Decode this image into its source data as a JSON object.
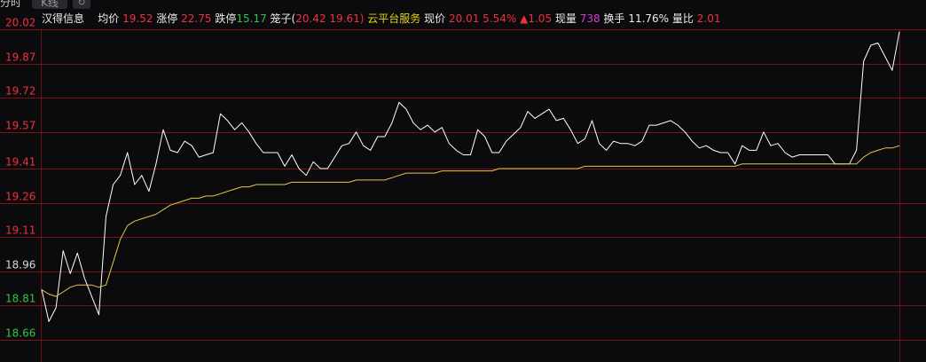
{
  "tabs": [
    {
      "label": "分时"
    },
    {
      "label": "K线"
    },
    {
      "label": "↻"
    }
  ],
  "info": {
    "name": "汉得信息",
    "avg_label": "均价",
    "avg": "19.52",
    "limit_up_label": "涨停",
    "limit_up": "22.75",
    "limit_down_label": "跌停",
    "limit_down": "15.17",
    "bidask_label": "笼子(",
    "bid": "20.42",
    "ask": "19.61)",
    "concept": "云平台服务",
    "price_label": "现价",
    "price": "20.01",
    "change_pct": "5.54%",
    "change": "▲1.05",
    "volume_label": "现量",
    "volume": "738",
    "turnover_label": "换手",
    "turnover": "11.76%",
    "ratio_label": "量比",
    "ratio": "2.01"
  },
  "colors": {
    "price_line": "#ffffff",
    "avg_line": "#e6c64a",
    "up": "#f0303c",
    "down": "#2fc24b",
    "grid": "#7a1414",
    "vline": "#6a1212"
  },
  "chart_data": {
    "type": "line",
    "y_ticks": [
      "20.02",
      "19.87",
      "19.72",
      "19.57",
      "19.41",
      "19.26",
      "19.11",
      "18.96",
      "18.81",
      "18.66"
    ],
    "y_tick_values": [
      20.02,
      19.87,
      19.72,
      19.57,
      19.41,
      19.26,
      19.11,
      18.96,
      18.81,
      18.66
    ],
    "ylim": [
      18.62,
      20.02
    ],
    "prev_close": 18.96,
    "series": [
      {
        "name": "",
        "values": [
          18.88,
          18.74,
          18.8,
          19.05,
          18.95,
          19.04,
          18.93,
          18.85,
          18.77,
          19.2,
          19.34,
          19.38,
          19.48,
          19.34,
          19.38,
          19.31,
          19.43,
          19.58,
          19.49,
          19.48,
          19.53,
          19.51,
          19.46,
          19.47,
          19.48,
          19.65,
          19.62,
          19.58,
          19.61,
          19.57,
          19.52,
          19.48,
          19.48,
          19.48,
          19.42,
          19.47,
          19.41,
          19.38,
          19.44,
          19.41,
          19.41,
          19.46,
          19.51,
          19.52,
          19.57,
          19.51,
          19.49,
          19.55,
          19.55,
          19.61,
          19.7,
          19.67,
          19.61,
          19.58,
          19.6,
          19.57,
          19.59,
          19.52,
          19.49,
          19.47,
          19.47,
          19.58,
          19.55,
          19.48,
          19.48,
          19.53,
          19.56,
          19.59,
          19.66,
          19.63,
          19.65,
          19.67,
          19.62,
          19.63,
          19.58,
          19.52,
          19.54,
          19.62,
          19.52,
          19.49,
          19.53,
          19.52,
          19.52,
          19.51,
          19.53,
          19.6,
          19.6,
          19.61,
          19.62,
          19.6,
          19.57,
          19.53,
          19.5,
          19.51,
          19.49,
          19.48,
          19.48,
          19.43,
          19.51,
          19.49,
          19.49,
          19.57,
          19.51,
          19.52,
          19.48,
          19.46,
          19.47,
          19.47,
          19.47,
          19.47,
          19.47,
          19.43,
          19.43,
          19.43,
          19.49,
          19.88,
          19.95,
          19.96,
          19.9,
          19.84,
          20.01
        ]
      },
      {
        "name": "",
        "values": [
          18.88,
          18.86,
          18.85,
          18.87,
          18.89,
          18.9,
          18.9,
          18.9,
          18.89,
          18.9,
          19.0,
          19.1,
          19.16,
          19.18,
          19.19,
          19.2,
          19.21,
          19.23,
          19.25,
          19.26,
          19.27,
          19.28,
          19.28,
          19.29,
          19.29,
          19.3,
          19.31,
          19.32,
          19.33,
          19.33,
          19.34,
          19.34,
          19.34,
          19.34,
          19.34,
          19.35,
          19.35,
          19.35,
          19.35,
          19.35,
          19.35,
          19.35,
          19.35,
          19.35,
          19.36,
          19.36,
          19.36,
          19.36,
          19.36,
          19.37,
          19.38,
          19.39,
          19.39,
          19.39,
          19.39,
          19.39,
          19.4,
          19.4,
          19.4,
          19.4,
          19.4,
          19.4,
          19.4,
          19.4,
          19.41,
          19.41,
          19.41,
          19.41,
          19.41,
          19.41,
          19.41,
          19.41,
          19.41,
          19.41,
          19.41,
          19.41,
          19.42,
          19.42,
          19.42,
          19.42,
          19.42,
          19.42,
          19.42,
          19.42,
          19.42,
          19.42,
          19.42,
          19.42,
          19.42,
          19.42,
          19.42,
          19.42,
          19.42,
          19.42,
          19.42,
          19.42,
          19.42,
          19.42,
          19.43,
          19.43,
          19.43,
          19.43,
          19.43,
          19.43,
          19.43,
          19.43,
          19.43,
          19.43,
          19.43,
          19.43,
          19.43,
          19.43,
          19.43,
          19.43,
          19.43,
          19.46,
          19.48,
          19.49,
          19.5,
          19.5,
          19.51
        ]
      }
    ],
    "grid": true
  }
}
